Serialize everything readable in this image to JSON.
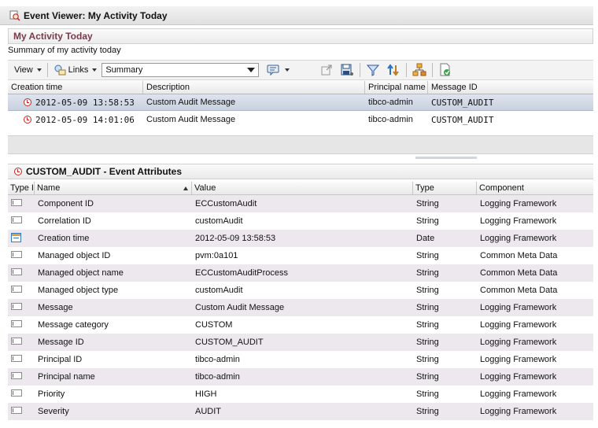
{
  "window": {
    "title": "Event Viewer: My Activity Today",
    "title_icon": "magnifier-event-icon"
  },
  "panel": {
    "title": "My Activity Today",
    "summary": "Summary of my activity today"
  },
  "toolbar": {
    "view_label": "View",
    "links_label": "Links",
    "select_value": "Summary",
    "icons": [
      "comment-icon",
      "export-icon",
      "save-icon",
      "filter-icon",
      "sort-icon",
      "hierarchy-icon",
      "refresh-document-icon"
    ]
  },
  "events_grid": {
    "columns": [
      "Creation time",
      "Description",
      "Principal name",
      "Message ID"
    ],
    "rows": [
      {
        "time": "2012-05-09 13:58:53",
        "description": "Custom Audit Message",
        "principal": "tibco-admin",
        "message_id": "CUSTOM_AUDIT",
        "selected": true
      },
      {
        "time": "2012-05-09 14:01:06",
        "description": "Custom Audit Message",
        "principal": "tibco-admin",
        "message_id": "CUSTOM_AUDIT",
        "selected": false
      }
    ]
  },
  "attributes": {
    "title": "CUSTOM_AUDIT - Event Attributes",
    "columns": [
      "Type I",
      "Name",
      "Value",
      "Type",
      "Component"
    ],
    "rows": [
      {
        "name": "Component ID",
        "value": "ECCustomAudit",
        "type": "String",
        "component": "Logging Framework",
        "icon": "string"
      },
      {
        "name": "Correlation ID",
        "value": "customAudit",
        "type": "String",
        "component": "Logging Framework",
        "icon": "string"
      },
      {
        "name": "Creation time",
        "value": "2012-05-09 13:58:53",
        "type": "Date",
        "component": "Logging Framework",
        "icon": "date"
      },
      {
        "name": "Managed object ID",
        "value": "pvm:0a101",
        "type": "String",
        "component": "Common Meta Data",
        "icon": "string"
      },
      {
        "name": "Managed object name",
        "value": "ECCustomAuditProcess",
        "type": "String",
        "component": "Common Meta Data",
        "icon": "string"
      },
      {
        "name": "Managed object type",
        "value": "customAudit",
        "type": "String",
        "component": "Common Meta Data",
        "icon": "string"
      },
      {
        "name": "Message",
        "value": "Custom Audit Message",
        "type": "String",
        "component": "Logging Framework",
        "icon": "string"
      },
      {
        "name": "Message category",
        "value": "CUSTOM",
        "type": "String",
        "component": "Logging Framework",
        "icon": "string"
      },
      {
        "name": "Message ID",
        "value": "CUSTOM_AUDIT",
        "type": "String",
        "component": "Logging Framework",
        "icon": "string"
      },
      {
        "name": "Principal ID",
        "value": "tibco-admin",
        "type": "String",
        "component": "Logging Framework",
        "icon": "string"
      },
      {
        "name": "Principal name",
        "value": "tibco-admin",
        "type": "String",
        "component": "Logging Framework",
        "icon": "string"
      },
      {
        "name": "Priority",
        "value": "HIGH",
        "type": "String",
        "component": "Logging Framework",
        "icon": "string"
      },
      {
        "name": "Severity",
        "value": "AUDIT",
        "type": "String",
        "component": "Logging Framework",
        "icon": "string"
      }
    ]
  }
}
